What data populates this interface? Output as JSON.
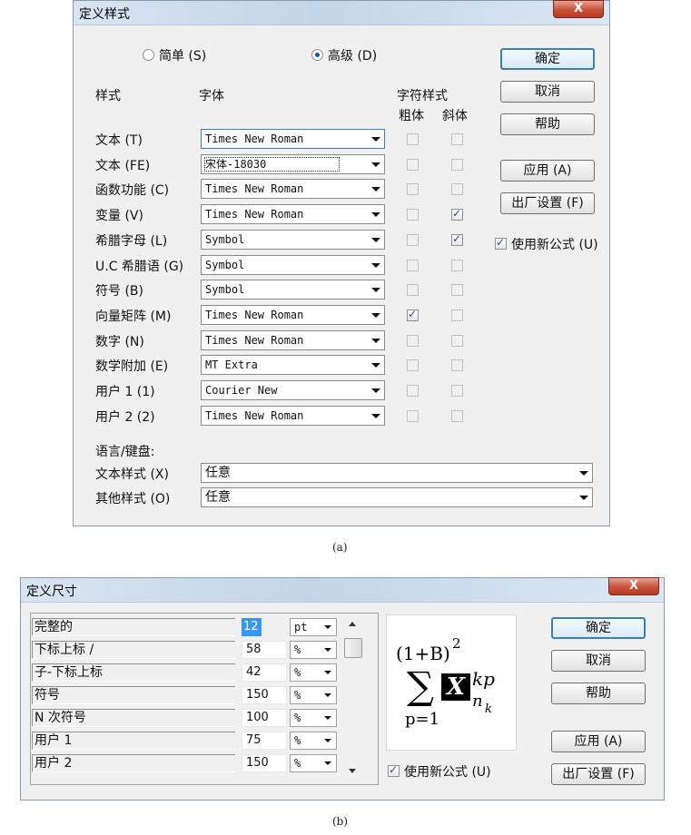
{
  "dialog_a": {
    "title": "定义样式",
    "close": "X",
    "mode": {
      "simple_label": "简单 (S)",
      "advanced_label": "高级 (D)",
      "selected": "advanced"
    },
    "headers": {
      "style": "样式",
      "font": "字体",
      "char_style": "字符样式",
      "bold": "粗体",
      "italic": "斜体"
    },
    "rows": [
      {
        "label": "文本 (T)",
        "font": "Times New Roman",
        "bold": false,
        "italic": false
      },
      {
        "label": "文本 (FE)",
        "font": "宋体-18030",
        "bold": false,
        "italic": false
      },
      {
        "label": "函数功能 (C)",
        "font": "Times New Roman",
        "bold": false,
        "italic": false
      },
      {
        "label": "变量 (V)",
        "font": "Times New Roman",
        "bold": false,
        "italic": true
      },
      {
        "label": "希腊字母 (L)",
        "font": "Symbol",
        "bold": false,
        "italic": true
      },
      {
        "label": "U.C 希腊语 (G)",
        "font": "Symbol",
        "bold": false,
        "italic": false
      },
      {
        "label": "符号 (B)",
        "font": "Symbol",
        "bold": false,
        "italic": false
      },
      {
        "label": "向量矩阵 (M)",
        "font": "Times New Roman",
        "bold": true,
        "italic": false
      },
      {
        "label": "数字 (N)",
        "font": "Times New Roman",
        "bold": false,
        "italic": false
      },
      {
        "label": "数学附加 (E)",
        "font": "MT Extra",
        "bold": false,
        "italic": false
      },
      {
        "label": "用户 1 (1)",
        "font": "Courier New",
        "bold": false,
        "italic": false
      },
      {
        "label": "用户 2 (2)",
        "font": "Times New Roman",
        "bold": false,
        "italic": false
      }
    ],
    "language_label": "语言/键盘:",
    "text_style_label": "文本样式 (X)",
    "text_style_value": "任意",
    "other_style_label": "其他样式 (O)",
    "other_style_value": "任意",
    "buttons": {
      "ok": "确定",
      "cancel": "取消",
      "help": "帮助",
      "apply": "应用 (A)",
      "factory": "出厂设置 (F)"
    },
    "use_new_formula": {
      "label": "使用新公式 (U)",
      "checked": true
    },
    "caption": "(a)"
  },
  "dialog_b": {
    "title": "定义尺寸",
    "close": "X",
    "rows": [
      {
        "label": "完整的",
        "value": "12",
        "unit": "pt"
      },
      {
        "label": "下标上标 /",
        "value": "58",
        "unit": "%"
      },
      {
        "label": "子-下标上标",
        "value": "42",
        "unit": "%"
      },
      {
        "label": "符号",
        "value": "150",
        "unit": "%"
      },
      {
        "label": "N 次符号",
        "value": "100",
        "unit": "%"
      },
      {
        "label": "用户 1",
        "value": "75",
        "unit": "%"
      },
      {
        "label": "用户 2",
        "value": "150",
        "unit": "%"
      }
    ],
    "preview": {
      "paren_expr": "(1+B)",
      "power": "2",
      "sum_symbol": "∑",
      "x_char": "X",
      "sup": "kp",
      "sub_n": "n",
      "sub_k": "k",
      "lower": "p=1"
    },
    "use_new_formula": {
      "label": "使用新公式 (U)",
      "checked": true
    },
    "buttons": {
      "ok": "确定",
      "cancel": "取消",
      "help": "帮助",
      "apply": "应用 (A)",
      "factory": "出厂设置 (F)"
    },
    "caption": "(b)"
  }
}
